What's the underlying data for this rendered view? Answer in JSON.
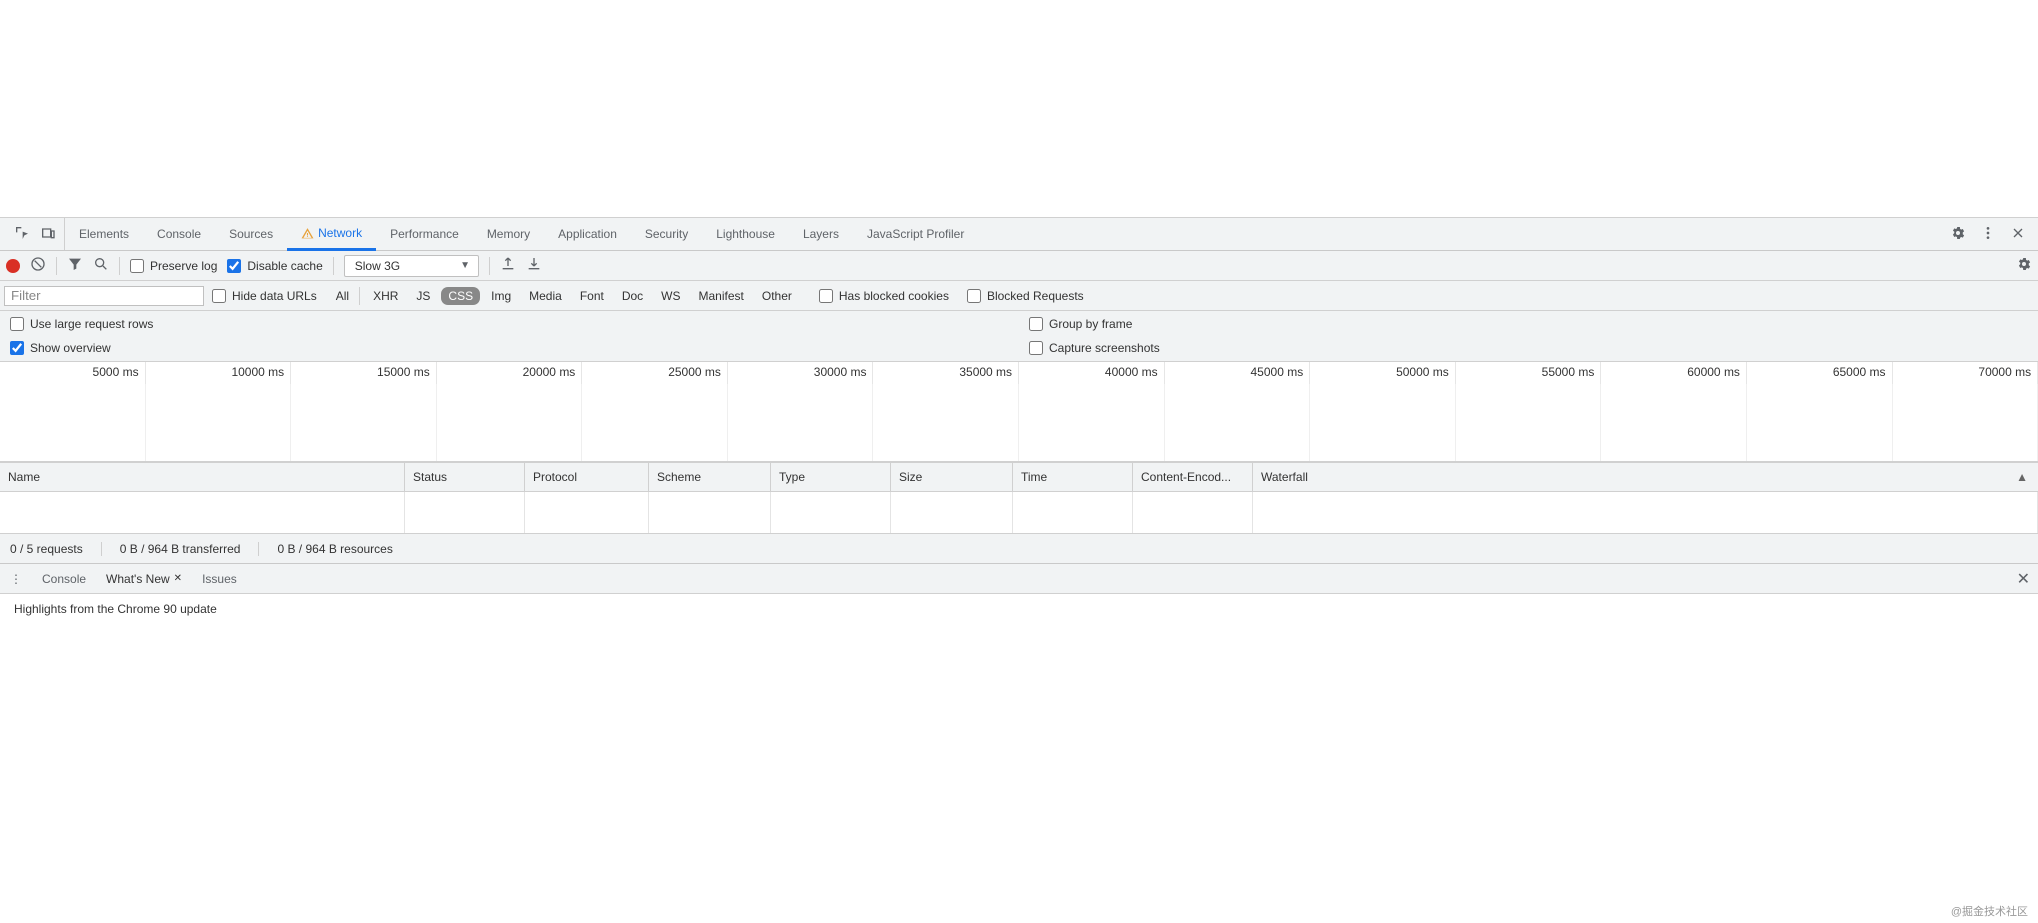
{
  "mainTabs": {
    "items": [
      "Elements",
      "Console",
      "Sources",
      "Network",
      "Performance",
      "Memory",
      "Application",
      "Security",
      "Lighthouse",
      "Layers",
      "JavaScript Profiler"
    ],
    "active": "Network",
    "hasWarning": true
  },
  "networkToolbar": {
    "preserveLog": {
      "label": "Preserve log",
      "checked": false
    },
    "disableCache": {
      "label": "Disable cache",
      "checked": true
    },
    "throttling": "Slow 3G"
  },
  "filterRow": {
    "placeholder": "Filter",
    "hideDataUrls": {
      "label": "Hide data URLs",
      "checked": false
    },
    "types": [
      "All",
      "XHR",
      "JS",
      "CSS",
      "Img",
      "Media",
      "Font",
      "Doc",
      "WS",
      "Manifest",
      "Other"
    ],
    "typeActive": "CSS",
    "hasBlockedCookies": {
      "label": "Has blocked cookies",
      "checked": false
    },
    "blockedRequests": {
      "label": "Blocked Requests",
      "checked": false
    }
  },
  "settings": {
    "useLargeRows": {
      "label": "Use large request rows",
      "checked": false
    },
    "showOverview": {
      "label": "Show overview",
      "checked": true
    },
    "groupByFrame": {
      "label": "Group by frame",
      "checked": false
    },
    "captureScreenshots": {
      "label": "Capture screenshots",
      "checked": false
    }
  },
  "timeline": {
    "ticks": [
      "5000 ms",
      "10000 ms",
      "15000 ms",
      "20000 ms",
      "25000 ms",
      "30000 ms",
      "35000 ms",
      "40000 ms",
      "45000 ms",
      "50000 ms",
      "55000 ms",
      "60000 ms",
      "65000 ms",
      "70000 ms"
    ]
  },
  "table": {
    "columns": [
      "Name",
      "Status",
      "Protocol",
      "Scheme",
      "Type",
      "Size",
      "Time",
      "Content-Encod...",
      "Waterfall"
    ]
  },
  "statusBar": {
    "requests": "0 / 5 requests",
    "transferred": "0 B / 964 B transferred",
    "resources": "0 B / 964 B resources"
  },
  "drawer": {
    "tabs": [
      "Console",
      "What's New",
      "Issues"
    ],
    "active": "What's New",
    "body": "Highlights from the Chrome 90 update"
  },
  "watermark": "@掘金技术社区"
}
